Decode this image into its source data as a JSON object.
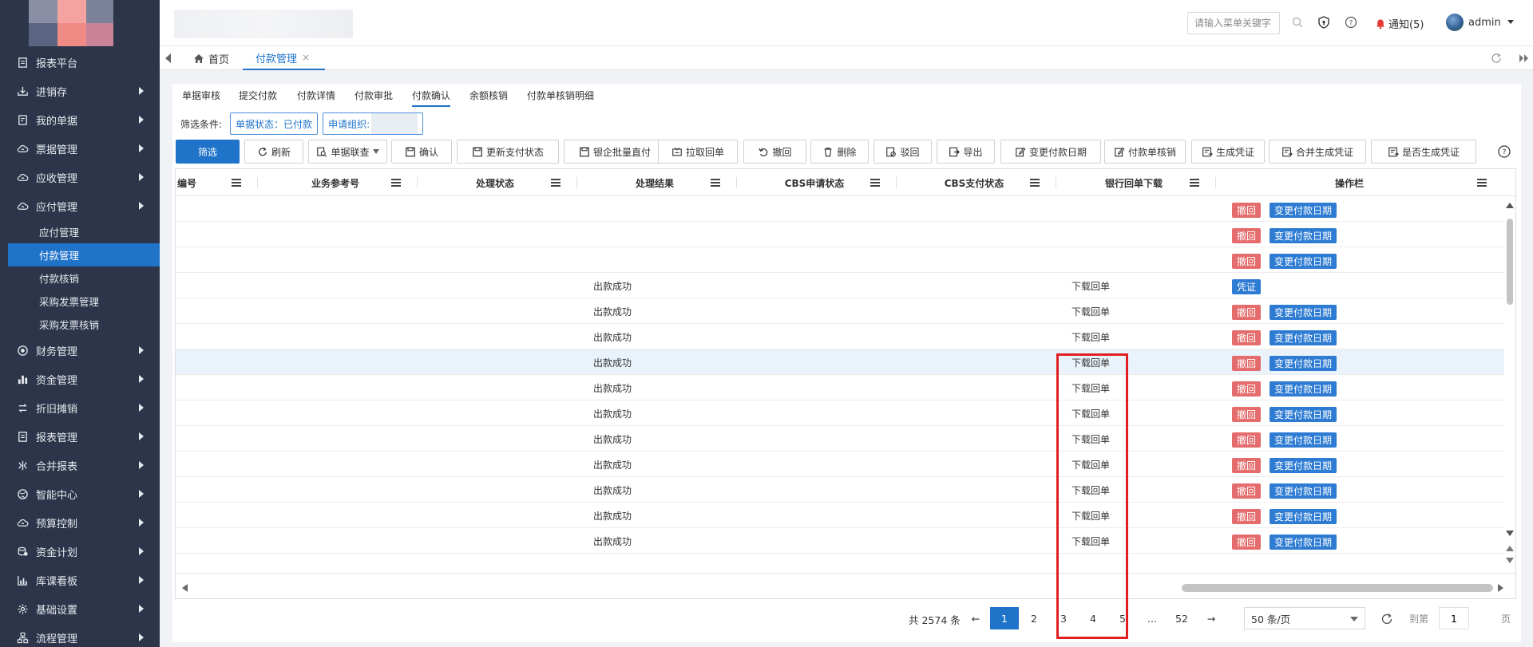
{
  "sidebar": {
    "items": [
      {
        "label": "报表平台",
        "icon": "report-icon",
        "arrow": false
      },
      {
        "label": "进销存",
        "icon": "download-tray-icon",
        "arrow": true
      },
      {
        "label": "我的单据",
        "icon": "document-icon",
        "arrow": true
      },
      {
        "label": "票据管理",
        "icon": "cloud-up-icon",
        "arrow": true
      },
      {
        "label": "应收管理",
        "icon": "cloud-up-icon",
        "arrow": true
      },
      {
        "label": "应付管理",
        "icon": "cloud-up-icon",
        "arrow": true
      }
    ],
    "sub_items": [
      "应付管理",
      "付款管理",
      "付款核销",
      "采购发票管理",
      "采购发票核销"
    ],
    "items_after": [
      {
        "label": "财务管理",
        "icon": "target-icon"
      },
      {
        "label": "资金管理",
        "icon": "bar-chart-icon"
      },
      {
        "label": "折旧摊销",
        "icon": "cycle-icon"
      },
      {
        "label": "报表管理",
        "icon": "report-icon"
      },
      {
        "label": "合并报表",
        "icon": "merge-icon"
      },
      {
        "label": "智能中心",
        "icon": "globe-icon"
      },
      {
        "label": "预算控制",
        "icon": "cloud-up-icon"
      },
      {
        "label": "资金计划",
        "icon": "coins-icon"
      },
      {
        "label": "库课看板",
        "icon": "chart-board-icon"
      },
      {
        "label": "基础设置",
        "icon": "gear-icon"
      },
      {
        "label": "流程管理",
        "icon": "flow-icon"
      }
    ]
  },
  "topbar": {
    "search_placeholder": "请输入菜单关键字",
    "notice_label": "通知(5)",
    "user_name": "admin"
  },
  "tabs": {
    "home": "首页",
    "active": "付款管理",
    "close": "×"
  },
  "subtabs": [
    "单据审核",
    "提交付款",
    "付款详情",
    "付款审批",
    "付款确认",
    "余额核销",
    "付款单核销明细"
  ],
  "filter": {
    "label": "筛选条件:",
    "chip_status": "单据状态：已付款",
    "chip_org": "申请组织:"
  },
  "toolbar": [
    {
      "label": "筛选",
      "icon": "",
      "primary": true
    },
    {
      "label": "刷新",
      "icon": "refresh-icon"
    },
    {
      "label": "单据联查",
      "icon": "search-doc-icon",
      "dropdown": true
    },
    {
      "label": "确认",
      "icon": "save-icon"
    },
    {
      "label": "更新支付状态",
      "icon": "save-icon"
    },
    {
      "label": "银企批量直付",
      "icon": "save-icon"
    },
    {
      "label": "拉取回单",
      "icon": "pull-icon"
    },
    {
      "label": "撤回",
      "icon": "undo-icon"
    },
    {
      "label": "删除",
      "icon": "trash-icon"
    },
    {
      "label": "驳回",
      "icon": "reject-icon"
    },
    {
      "label": "导出",
      "icon": "export-icon"
    },
    {
      "label": "变更付款日期",
      "icon": "edit-icon"
    },
    {
      "label": "付款单核销",
      "icon": "edit-icon"
    },
    {
      "label": "生成凭证",
      "icon": "voucher-icon"
    },
    {
      "label": "合并生成凭证",
      "icon": "voucher-icon"
    },
    {
      "label": "是否生成凭证",
      "icon": "voucher-icon"
    }
  ],
  "grid": {
    "columns": [
      "编号",
      "业务参考号",
      "处理状态",
      "处理结果",
      "CBS申请状态",
      "CBS支付状态",
      "银行回单下载",
      "操作栏"
    ],
    "rows": [
      {
        "result": "",
        "download": "",
        "ops": [
          "撤回",
          "变更付款日期"
        ]
      },
      {
        "result": "",
        "download": "",
        "ops": [
          "撤回",
          "变更付款日期"
        ]
      },
      {
        "result": "",
        "download": "",
        "ops": [
          "撤回",
          "变更付款日期"
        ]
      },
      {
        "result": "出款成功",
        "download": "下载回单",
        "ops": [
          "凭证"
        ]
      },
      {
        "result": "出款成功",
        "download": "下载回单",
        "ops": [
          "撤回",
          "变更付款日期"
        ]
      },
      {
        "result": "出款成功",
        "download": "下载回单",
        "ops": [
          "撤回",
          "变更付款日期"
        ]
      },
      {
        "result": "出款成功",
        "download": "下载回单",
        "ops": [
          "撤回",
          "变更付款日期"
        ]
      },
      {
        "result": "出款成功",
        "download": "下载回单",
        "ops": [
          "撤回",
          "变更付款日期"
        ]
      },
      {
        "result": "出款成功",
        "download": "下载回单",
        "ops": [
          "撤回",
          "变更付款日期"
        ]
      },
      {
        "result": "出款成功",
        "download": "下载回单",
        "ops": [
          "撤回",
          "变更付款日期"
        ]
      },
      {
        "result": "出款成功",
        "download": "下载回单",
        "ops": [
          "撤回",
          "变更付款日期"
        ]
      },
      {
        "result": "出款成功",
        "download": "下载回单",
        "ops": [
          "撤回",
          "变更付款日期"
        ]
      },
      {
        "result": "出款成功",
        "download": "下载回单",
        "ops": [
          "撤回",
          "变更付款日期"
        ]
      },
      {
        "result": "出款成功",
        "download": "下载回单",
        "ops": [
          "撤回",
          "变更付款日期"
        ]
      }
    ],
    "highlighted_row": 6
  },
  "pager": {
    "total": "共 2574 条",
    "prev": "←",
    "next": "→",
    "pages": [
      "1",
      "2",
      "3",
      "4",
      "5",
      "...",
      "52"
    ],
    "current": "1",
    "page_size": "50 条/页",
    "goto": "到第",
    "goto_value": "1",
    "page_suffix": "页"
  },
  "colors": {
    "sidebar_bg": "#2c3549",
    "accent": "#1f73c9",
    "danger": "#e46c6c",
    "highlight_box": "#e02020"
  }
}
